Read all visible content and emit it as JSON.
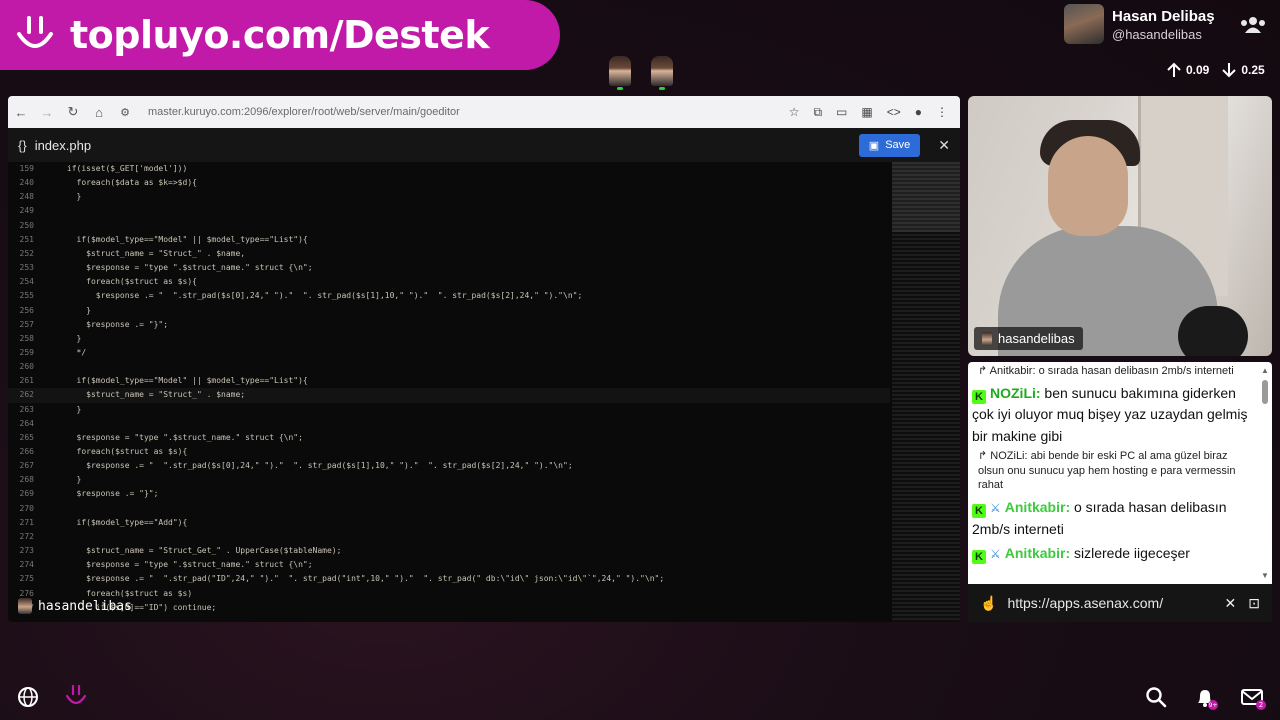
{
  "banner": {
    "text": "topluyo.com/Destek"
  },
  "profile": {
    "name": "Hasan Delibaş",
    "handle": "@hasandelibas"
  },
  "stats": {
    "up": "0.09",
    "down": "0.25"
  },
  "browser": {
    "url": "master.kuruyo.com:2096/explorer/root/web/server/main/goeditor"
  },
  "editor": {
    "filename": "index.php",
    "save_label": "Save",
    "lines": [
      {
        "n": "159",
        "t": "if(isset($_GET['model']))"
      },
      {
        "n": "240",
        "t": "  foreach($data as $k=>$d){"
      },
      {
        "n": "248",
        "t": "  }"
      },
      {
        "n": "249",
        "t": ""
      },
      {
        "n": "250",
        "t": ""
      },
      {
        "n": "251",
        "t": "  if($model_type==\"Model\" || $model_type==\"List\"){"
      },
      {
        "n": "252",
        "t": "    $struct_name = \"Struct_\" . $name,"
      },
      {
        "n": "253",
        "t": "    $response = \"type \".$struct_name.\" struct {\\n\";"
      },
      {
        "n": "254",
        "t": "    foreach($struct as $s){"
      },
      {
        "n": "255",
        "t": "      $response .= \"  \".str_pad($s[0],24,\" \").\"  \". str_pad($s[1],10,\" \").\"  \". str_pad($s[2],24,\" \").\"\\n\";"
      },
      {
        "n": "256",
        "t": "    }"
      },
      {
        "n": "257",
        "t": "    $response .= \"}\";"
      },
      {
        "n": "258",
        "t": "  }"
      },
      {
        "n": "259",
        "t": "  */"
      },
      {
        "n": "260",
        "t": ""
      },
      {
        "n": "261",
        "t": "  if($model_type==\"Model\" || $model_type==\"List\"){"
      },
      {
        "n": "262",
        "t": "    $struct_name = \"Struct_\" . $name;"
      },
      {
        "n": "263",
        "t": "  }"
      },
      {
        "n": "264",
        "t": ""
      },
      {
        "n": "265",
        "t": "  $response = \"type \".$struct_name.\" struct {\\n\";"
      },
      {
        "n": "266",
        "t": "  foreach($struct as $s){"
      },
      {
        "n": "267",
        "t": "    $response .= \"  \".str_pad($s[0],24,\" \").\"  \". str_pad($s[1],10,\" \").\"  \". str_pad($s[2],24,\" \").\"\\n\";"
      },
      {
        "n": "268",
        "t": "  }"
      },
      {
        "n": "269",
        "t": "  $response .= \"}\";"
      },
      {
        "n": "270",
        "t": ""
      },
      {
        "n": "271",
        "t": "  if($model_type==\"Add\"){"
      },
      {
        "n": "272",
        "t": ""
      },
      {
        "n": "273",
        "t": "    $struct_name = \"Struct_Get_\" . UpperCase($tableName);"
      },
      {
        "n": "274",
        "t": "    $response = \"type \".$struct_name.\" struct {\\n\";"
      },
      {
        "n": "275",
        "t": "    $response .= \"  \".str_pad(\"ID\",24,\" \").\"  \". str_pad(\"int\",10,\" \").\"  \". str_pad(\" db:\\\"id\\\" json:\\\"id\\\"`\",24,\" \").\"\\n\";"
      },
      {
        "n": "276",
        "t": "    foreach($struct as $s)"
      },
      {
        "n": "277",
        "t": "      if($s[0]==\"ID\") continue;"
      }
    ],
    "presenter": "hasandelibas"
  },
  "camera": {
    "label": "hasandelibas"
  },
  "chat": {
    "reply1": "Anitkabir: o sırada hasan delibasın 2mb/s interneti",
    "msg1_user": "NOZiLi:",
    "msg1_text": " ben sunucu bakımına giderken çok iyi oluyor muq bişey yaz uzaydan gelmiş bir makine gibi",
    "reply2": "NOZiLi: abi bende bir eski PC al ama güzel biraz olsun onu sunucu yap hem hosting e para vermessin rahat",
    "msg2_user": "Anitkabir:",
    "msg2_text": " o sırada hasan delibasın 2mb/s interneti",
    "msg3_user": "Anitkabir:",
    "msg3_text": " sizlerede iigeceşer"
  },
  "urlbar": {
    "url": "https://apps.asenax.com/"
  },
  "colors": {
    "brand": "#c21aa8",
    "kick_green": "#53fc18",
    "save_blue": "#2d6bd8"
  }
}
